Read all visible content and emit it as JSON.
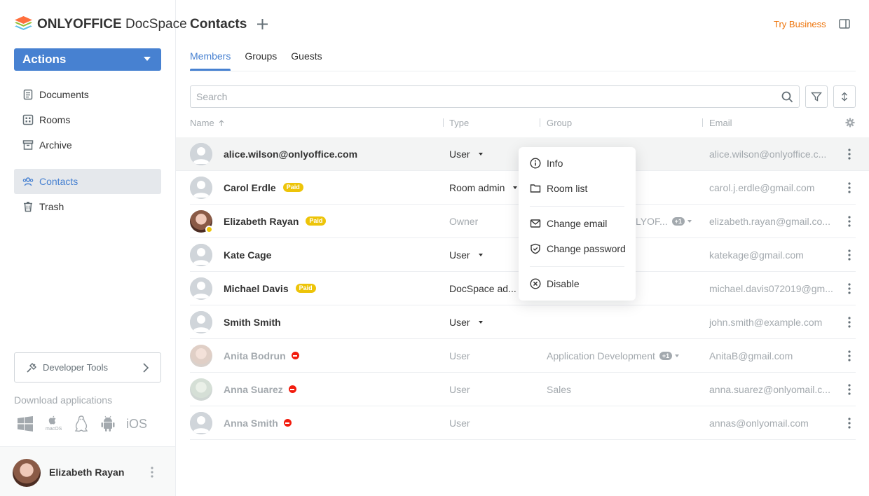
{
  "logo": {
    "brand": "ONLYOFFICE",
    "product": "DocSpace"
  },
  "actions_label": "Actions",
  "nav": [
    {
      "label": "Documents",
      "icon": "document-icon"
    },
    {
      "label": "Rooms",
      "icon": "rooms-icon"
    },
    {
      "label": "Archive",
      "icon": "archive-icon"
    },
    {
      "label": "Contacts",
      "icon": "contacts-icon",
      "active": true
    },
    {
      "label": "Trash",
      "icon": "trash-icon"
    }
  ],
  "dev_tools_label": "Developer Tools",
  "download_title": "Download applications",
  "apps": {
    "ios_label": "iOS",
    "macos_label": "macOS"
  },
  "profile": {
    "name": "Elizabeth Rayan"
  },
  "page_title": "Contacts",
  "try_business": "Try Business",
  "tabs": [
    "Members",
    "Groups",
    "Guests"
  ],
  "search": {
    "placeholder": "Search"
  },
  "columns": {
    "name": "Name",
    "type": "Type",
    "group": "Group",
    "email": "Email"
  },
  "rows": [
    {
      "name": "alice.wilson@onlyoffice.com",
      "type": "User",
      "group": "",
      "email": "alice.wilson@onlyoffice.c..."
    },
    {
      "name": "Carol Erdle",
      "paid": "Paid",
      "type": "Room admin",
      "group": "",
      "email": "carol.j.erdle@gmail.com"
    },
    {
      "name": "Elizabeth Rayan",
      "paid": "Paid",
      "type": "Owner",
      "group": "LYOF...",
      "group_extra": "+1",
      "email": "elizabeth.rayan@gmail.co..."
    },
    {
      "name": "Kate Cage",
      "type": "User",
      "group": "",
      "email": "katekage@gmail.com"
    },
    {
      "name": "Michael Davis",
      "paid": "Paid",
      "type": "DocSpace ad...",
      "group": "",
      "email": "michael.davis072019@gm..."
    },
    {
      "name": "Smith Smith",
      "type": "User",
      "group": "",
      "email": "john.smith@example.com"
    },
    {
      "name": "Anita Bodrun",
      "type": "User",
      "group": "Application Development",
      "group_extra": "+1",
      "email": "AnitaB@gmail.com"
    },
    {
      "name": "Anna Suarez",
      "type": "User",
      "group": "Sales",
      "email": "anna.suarez@onlyomail.c..."
    },
    {
      "name": "Anna Smith",
      "type": "User",
      "group": "",
      "email": "annas@onlyomail.com"
    }
  ],
  "context_menu": {
    "info": "Info",
    "room_list": "Room list",
    "change_email": "Change email",
    "change_password": "Change password",
    "disable": "Disable"
  },
  "colors": {
    "accent": "#4781d1",
    "paid": "#edc409",
    "try_business": "#ed7309",
    "blocked": "#f21c0e"
  }
}
